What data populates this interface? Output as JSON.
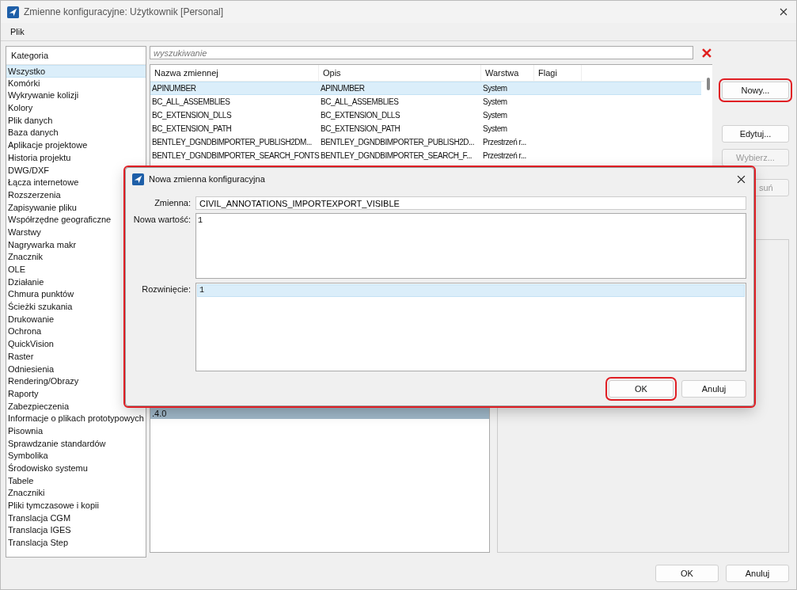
{
  "window": {
    "title": "Zmienne konfiguracyjne: Użytkownik [Personal]"
  },
  "menu": [
    {
      "label": "Plik"
    }
  ],
  "categories": {
    "header": "Kategoria",
    "items": [
      {
        "label": "Wszystko",
        "selected": true
      },
      {
        "label": "Komórki",
        "selected": false
      },
      {
        "label": "Wykrywanie kolizji",
        "selected": false
      },
      {
        "label": "Kolory",
        "selected": false
      },
      {
        "label": "Plik danych",
        "selected": false
      },
      {
        "label": "Baza danych",
        "selected": false
      },
      {
        "label": "Aplikacje projektowe",
        "selected": false
      },
      {
        "label": "Historia projektu",
        "selected": false
      },
      {
        "label": "DWG/DXF",
        "selected": false
      },
      {
        "label": "Łącza internetowe",
        "selected": false
      },
      {
        "label": "Rozszerzenia",
        "selected": false
      },
      {
        "label": "Zapisywanie pliku",
        "selected": false
      },
      {
        "label": "Współrzędne geograficzne",
        "selected": false
      },
      {
        "label": "Warstwy",
        "selected": false
      },
      {
        "label": "Nagrywarka makr",
        "selected": false
      },
      {
        "label": "Znacznik",
        "selected": false
      },
      {
        "label": "OLE",
        "selected": false
      },
      {
        "label": "Działanie",
        "selected": false
      },
      {
        "label": "Chmura punktów",
        "selected": false
      },
      {
        "label": "Ścieżki szukania",
        "selected": false
      },
      {
        "label": "Drukowanie",
        "selected": false
      },
      {
        "label": "Ochrona",
        "selected": false
      },
      {
        "label": "QuickVision",
        "selected": false
      },
      {
        "label": "Raster",
        "selected": false
      },
      {
        "label": "Odniesienia",
        "selected": false
      },
      {
        "label": "Rendering/Obrazy",
        "selected": false
      },
      {
        "label": "Raporty",
        "selected": false
      },
      {
        "label": "Zabezpieczenia",
        "selected": false
      },
      {
        "label": "Informacje o plikach prototypowych",
        "selected": false
      },
      {
        "label": "Pisownia",
        "selected": false
      },
      {
        "label": "Sprawdzanie standardów",
        "selected": false
      },
      {
        "label": "Symbolika",
        "selected": false
      },
      {
        "label": "Środowisko systemu",
        "selected": false
      },
      {
        "label": "Tabele",
        "selected": false
      },
      {
        "label": "Znaczniki",
        "selected": false
      },
      {
        "label": "Pliki tymczasowe i kopii",
        "selected": false
      },
      {
        "label": "Translacja CGM",
        "selected": false
      },
      {
        "label": "Translacja IGES",
        "selected": false
      },
      {
        "label": "Translacja Step",
        "selected": false
      }
    ]
  },
  "search": {
    "placeholder": "wyszukiwanie"
  },
  "table": {
    "columns": [
      "Nazwa zmiennej",
      "Opis",
      "Warstwa",
      "Flagi"
    ],
    "rows": [
      {
        "cells": [
          "APINUMBER",
          "APINUMBER",
          "System"
        ],
        "selected": true
      },
      {
        "cells": [
          "BC_ALL_ASSEMBLIES",
          "BC_ALL_ASSEMBLIES",
          "System"
        ],
        "selected": false
      },
      {
        "cells": [
          "BC_EXTENSION_DLLS",
          "BC_EXTENSION_DLLS",
          "System"
        ],
        "selected": false
      },
      {
        "cells": [
          "BC_EXTENSION_PATH",
          "BC_EXTENSION_PATH",
          "System"
        ],
        "selected": false
      },
      {
        "cells": [
          "BENTLEY_DGNDBIMPORTER_PUBLISH2DM...",
          "BENTLEY_DGNDBIMPORTER_PUBLISH2D...",
          "Przestrzeń r..."
        ],
        "selected": false
      },
      {
        "cells": [
          "BENTLEY_DGNDBIMPORTER_SEARCH_FONTS",
          "BENTLEY_DGNDBIMPORTER_SEARCH_F...",
          "Przestrzeń r..."
        ],
        "selected": false
      }
    ]
  },
  "side_buttons": [
    {
      "label": "Nowy...",
      "disabled": false,
      "highlighted": true
    },
    {
      "label": "Edytuj...",
      "disabled": false,
      "highlighted": false
    },
    {
      "label": "Wybierz...",
      "disabled": true,
      "highlighted": false
    },
    {
      "label": "suń",
      "disabled": true,
      "highlighted": false
    }
  ],
  "value_list": [
    {
      "label": ".4.0",
      "selected": true
    }
  ],
  "footer_buttons": [
    {
      "label": "OK"
    },
    {
      "label": "Anuluj"
    }
  ],
  "dialog": {
    "title": "Nowa zmienna konfiguracyjna",
    "highlighted": true,
    "variable": {
      "label": "Zmienna:",
      "value": "CIVIL_ANNOTATIONS_IMPORTEXPORT_VISIBLE"
    },
    "new_value": {
      "label": "Nowa wartość:",
      "value": "1"
    },
    "expansion": {
      "label": "Rozwinięcie:",
      "lines": [
        {
          "text": "1",
          "selected": true
        }
      ]
    },
    "buttons": [
      {
        "label": "OK",
        "highlighted": true
      },
      {
        "label": "Anuluj",
        "highlighted": false
      }
    ]
  }
}
